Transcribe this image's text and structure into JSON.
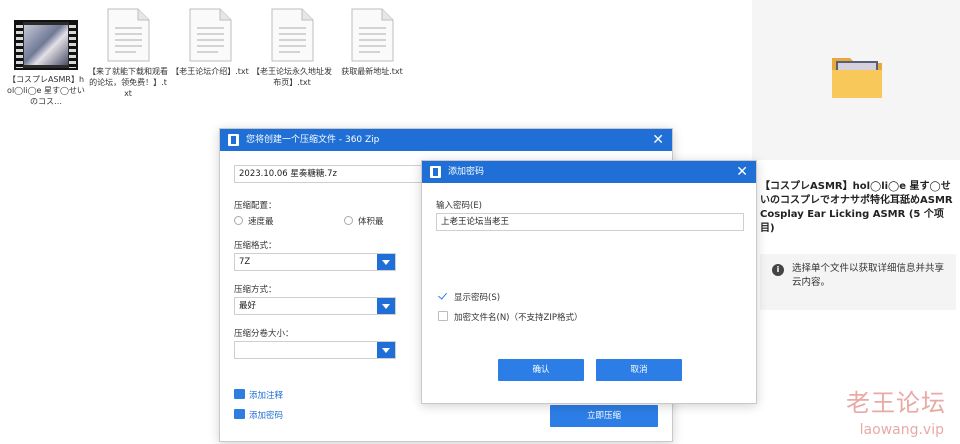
{
  "desktop": {
    "files": [
      {
        "name": "【コスプレASMR】hol◯li◯e 星す◯せいのコス…",
        "type": "video"
      },
      {
        "name": "【来了就能下载和观看的论坛，领免费！】.txt",
        "type": "txt"
      },
      {
        "name": "【老王论坛介绍】.txt",
        "type": "txt"
      },
      {
        "name": "【老王论坛永久地址发布页】.txt",
        "type": "txt"
      },
      {
        "name": "获取最新地址.txt",
        "type": "txt"
      }
    ]
  },
  "right_panel": {
    "folder_title": "【コスプレASMR】hol◯li◯e 星す◯せいのコスプレでオナサポ特化耳舐めASMR Cosplay Ear Licking ASMR (5 个项目)",
    "tip_text": "选择单个文件以获取详细信息并共享云内容。",
    "watermark": "老王论坛",
    "watermark_url": "laowang.vip"
  },
  "compress_dialog": {
    "title": "您将创建一个压缩文件 - 360 Zip",
    "filename": "2023.10.06 星奏糖糖.7z",
    "compression_config_label": "压缩配置：",
    "option_speed": "速度最",
    "option_size": "体积最",
    "format_label": "压缩格式：",
    "format_value": "7Z",
    "method_label": "压缩方式：",
    "method_value": "最好",
    "split_label": "压缩分卷大小：",
    "split_value": "",
    "add_comment": "添加注释",
    "add_password": "添加密码",
    "compress_now": "立即压缩"
  },
  "password_dialog": {
    "title": "添加密码",
    "input_label": "输入密码(E)",
    "password_value": "上老王论坛当老王",
    "show_password": "显示密码(S)",
    "encrypt_filenames": "加密文件名(N)（不支持ZIP格式）",
    "confirm": "确认",
    "cancel": "取消"
  },
  "colors": {
    "accent": "#1f6fd6",
    "button": "#2c7ee6",
    "watermark": "#e9aaa6"
  }
}
